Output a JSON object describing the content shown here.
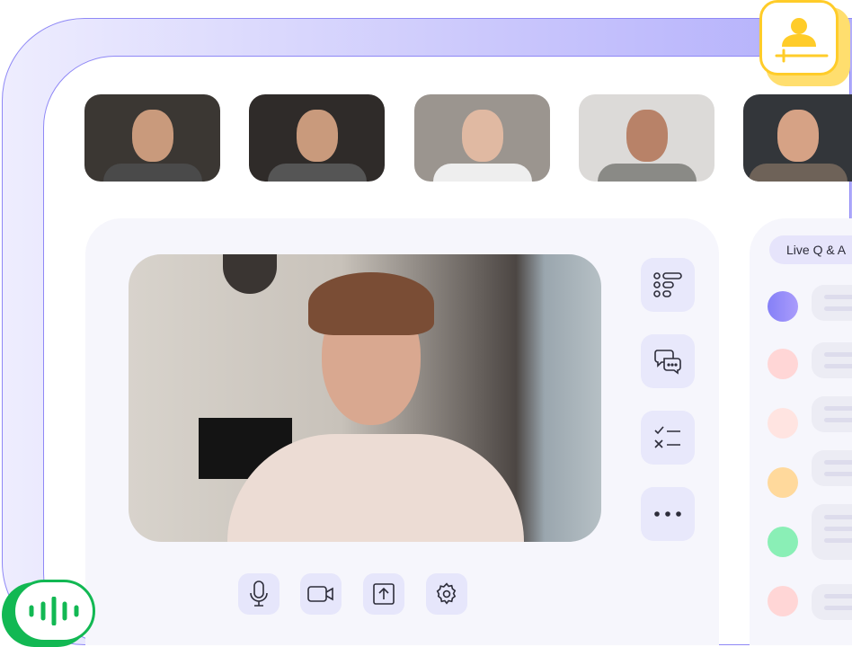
{
  "qa": {
    "label": "Live Q & A"
  },
  "participants": [
    {
      "name": "participant-1",
      "bg": "#3b3733"
    },
    {
      "name": "participant-2",
      "bg": "#2f2b29"
    },
    {
      "name": "participant-3",
      "bg": "#9b958f"
    },
    {
      "name": "participant-4",
      "bg": "#dcdad8"
    },
    {
      "name": "participant-5",
      "bg": "#33363a"
    }
  ],
  "side_tools": [
    "list-icon",
    "chat-icon",
    "checklist-icon",
    "more-icon"
  ],
  "controls": [
    "microphone-icon",
    "video-camera-icon",
    "share-screen-icon",
    "settings-icon"
  ],
  "chat_avatars": [
    "#8f8af7",
    "#ffd6d6",
    "#ffe4e1",
    "#ffd99c",
    "#8aefb6",
    "#ffd6d6"
  ],
  "colors": {
    "accent": "#8f88f6",
    "yellow": "#ffcc29",
    "green": "#12b853"
  }
}
